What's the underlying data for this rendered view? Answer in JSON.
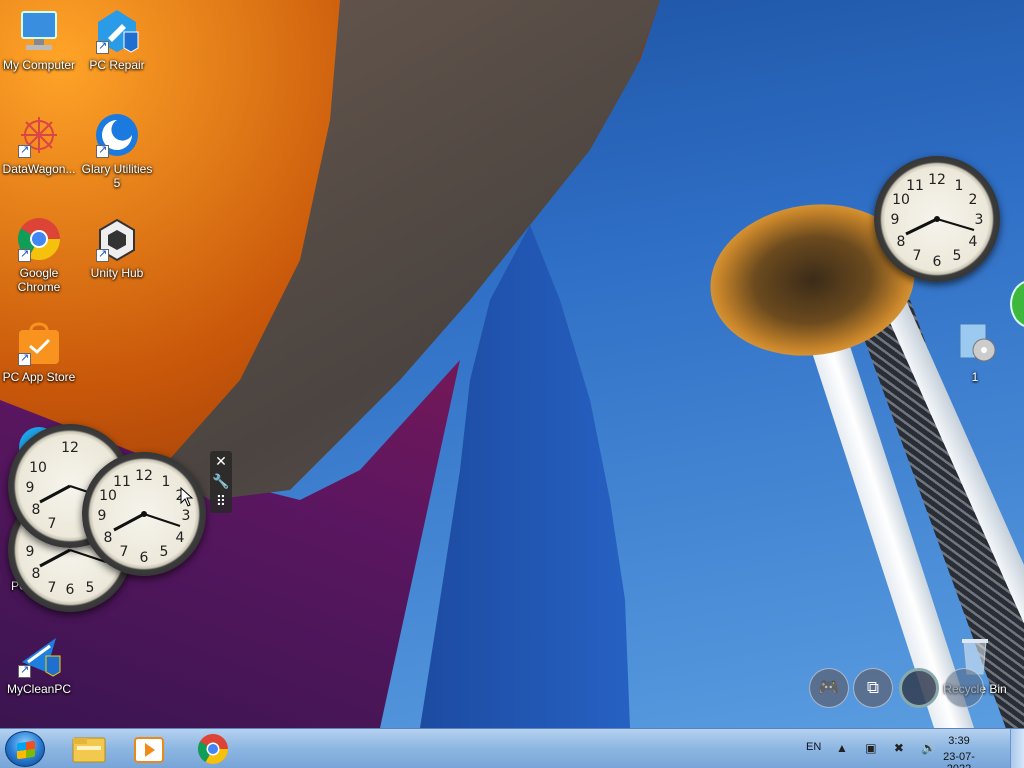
{
  "desktop_icons": [
    {
      "label": "My Computer"
    },
    {
      "label": "PC Repair"
    },
    {
      "label": "DataWagon..."
    },
    {
      "label": "Glary Utilities 5"
    },
    {
      "label": "Google Chrome"
    },
    {
      "label": "Unity Hub"
    },
    {
      "label": "PC App Store"
    },
    {
      "label": "PC"
    },
    {
      "label": "MyCleanPC"
    },
    {
      "label": "1"
    },
    {
      "label": "Recycle Bin"
    }
  ],
  "clock_numerals": [
    "12",
    "1",
    "2",
    "3",
    "4",
    "5",
    "6",
    "7",
    "8",
    "9",
    "10",
    "11"
  ],
  "gadget_toolbar": {
    "close_icon": "close-icon",
    "settings_icon": "wrench-icon",
    "drag_icon": "drag-grid-icon"
  },
  "floating_buttons": [
    {
      "icon": "gamepad-icon",
      "glyph": "🎮"
    },
    {
      "icon": "window-restore-icon",
      "glyph": "⧉"
    },
    {
      "icon": "circle-icon",
      "glyph": ""
    }
  ],
  "taskbar": {
    "pinned": [
      "windows-explorer-icon",
      "media-player-icon",
      "chrome-icon"
    ],
    "language": "EN",
    "tray_icons": "▲ ▣ ✖ 🔊",
    "time": "3:39",
    "date": "23-07-2022"
  }
}
